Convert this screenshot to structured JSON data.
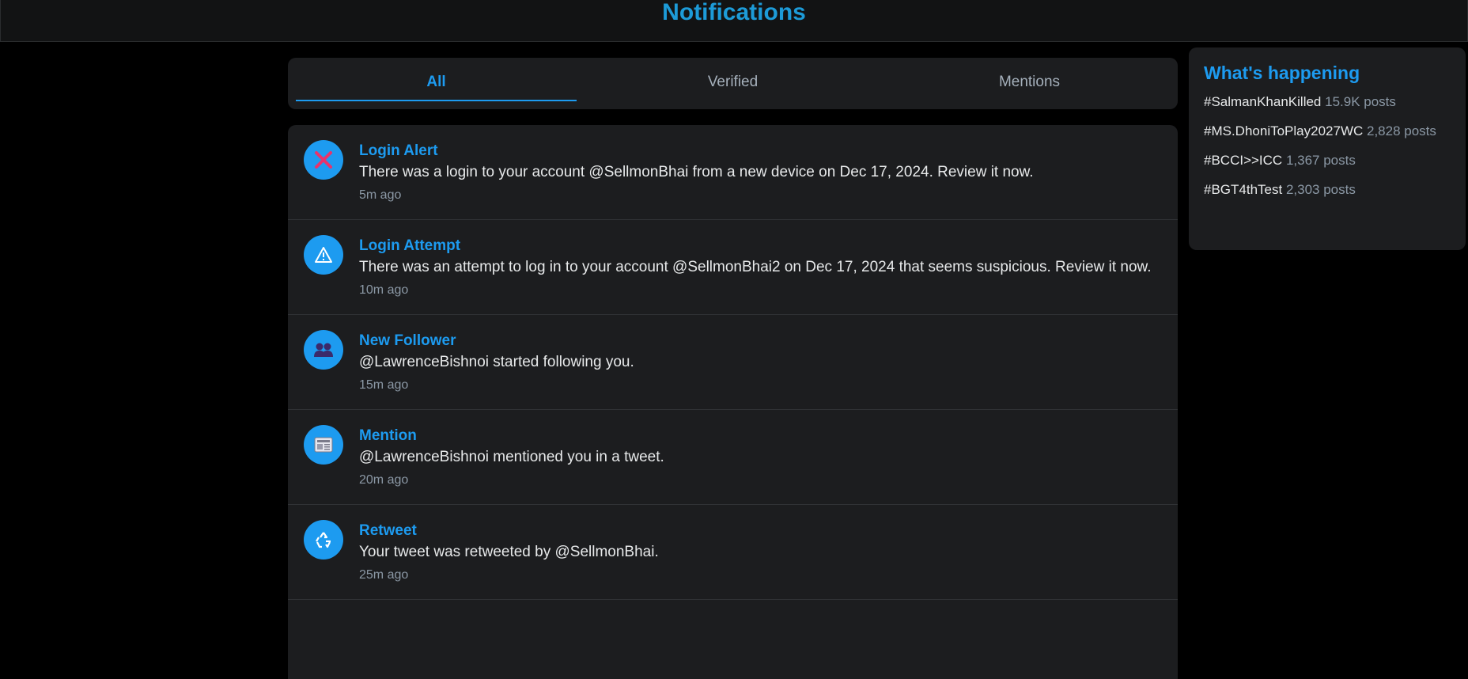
{
  "header": {
    "title": "Notifications"
  },
  "tabs": [
    {
      "label": "All",
      "active": true
    },
    {
      "label": "Verified",
      "active": false
    },
    {
      "label": "Mentions",
      "active": false
    }
  ],
  "notifications": [
    {
      "icon": "x-icon",
      "title": "Login Alert",
      "text": "There was a login to your account @SellmonBhai from a new device on Dec 17, 2024. Review it now.",
      "time": "5m ago"
    },
    {
      "icon": "warning-icon",
      "title": "Login Attempt",
      "text": "There was an attempt to log in to your account @SellmonBhai2 on Dec 17, 2024 that seems suspicious. Review it now.",
      "time": "10m ago"
    },
    {
      "icon": "users-icon",
      "title": "New Follower",
      "text": "@LawrenceBishnoi started following you.",
      "time": "15m ago"
    },
    {
      "icon": "newspaper-icon",
      "title": "Mention",
      "text": "@LawrenceBishnoi mentioned you in a tweet.",
      "time": "20m ago"
    },
    {
      "icon": "recycle-icon",
      "title": "Retweet",
      "text": "Your tweet was retweeted by @SellmonBhai.",
      "time": "25m ago"
    }
  ],
  "sidebar": {
    "title": "What's happening",
    "trends": [
      {
        "tag": "#SalmanKhanKilled",
        "count": "15.9K posts"
      },
      {
        "tag": "#MS.DhoniToPlay2027WC",
        "count": "2,828 posts"
      },
      {
        "tag": "#BCCI>>ICC",
        "count": "1,367 posts"
      },
      {
        "tag": "#BGT4thTest",
        "count": "2,303 posts"
      }
    ]
  },
  "colors": {
    "accent": "#1d9bf0",
    "background": "#000000",
    "card": "#1c1d1f"
  }
}
